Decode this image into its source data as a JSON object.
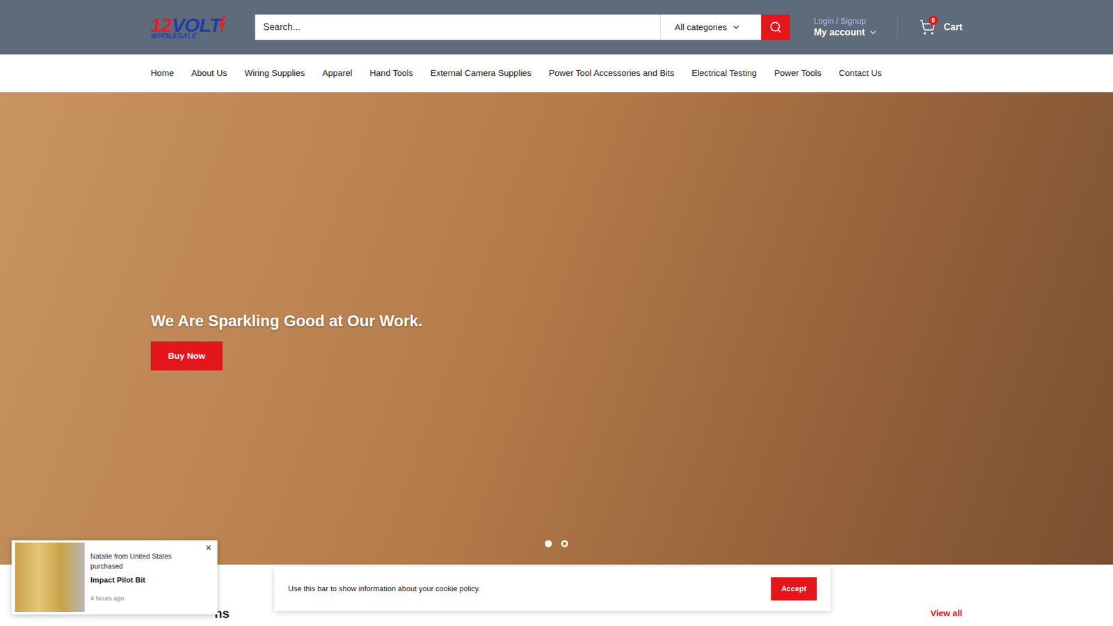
{
  "header": {
    "logo": {
      "main_a": "12",
      "main_b": "VOLT",
      "sub": "WHOLESALE"
    },
    "search": {
      "placeholder": "Search..."
    },
    "category": "All categories",
    "login": "Login / Signup",
    "account": "My account",
    "cart": {
      "label": "Cart",
      "count": "0"
    }
  },
  "nav": {
    "items": [
      "Home",
      "About Us",
      "Wiring Supplies",
      "Apparel",
      "Hand Tools",
      "External Camera Supplies",
      "Power Tool Accessories and Bits",
      "Electrical Testing",
      "Power Tools",
      "Contact Us"
    ]
  },
  "hero": {
    "title": "We Are Sparkling Good at Our Work.",
    "button": "Buy Now",
    "slides": [
      {
        "selected": true
      },
      {
        "selected": false
      }
    ]
  },
  "section": {
    "title": "ns",
    "link": "View all"
  },
  "popup": {
    "line": "Natalie from United States purchased",
    "product": "Impact Pilot Bit",
    "time": "4 hours ago",
    "close": "×"
  },
  "cookie": {
    "text": "Use this bar to show information about your cookie policy.",
    "button": "Accept"
  }
}
